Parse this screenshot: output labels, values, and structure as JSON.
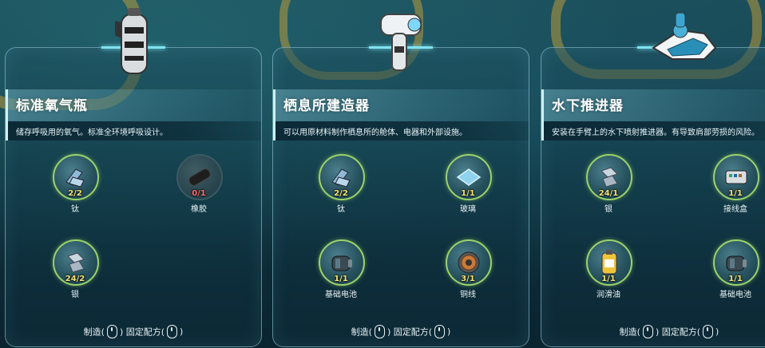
{
  "panels": [
    {
      "title": "标准氧气瓶",
      "description": "储存呼吸用的氧气。标准全环境呼吸设计。",
      "item_icon": "oxygen-tank-icon",
      "ingredients": [
        {
          "name": "钛",
          "count": "2/2",
          "icon": "titanium-icon",
          "available": true
        },
        {
          "name": "橡胶",
          "count": "0/1",
          "icon": "rubber-icon",
          "available": false
        },
        {
          "name": "银",
          "count": "24/2",
          "icon": "silver-icon",
          "available": true
        }
      ],
      "footer": {
        "craft": "制造(",
        "pin": ")   固定配方(",
        "end": ")"
      }
    },
    {
      "title": "栖息所建造器",
      "description": "可以用原材料制作栖息所的舱体、电器和外部设施。",
      "item_icon": "habitat-builder-icon",
      "ingredients": [
        {
          "name": "钛",
          "count": "2/2",
          "icon": "titanium-icon",
          "available": true
        },
        {
          "name": "玻璃",
          "count": "1/1",
          "icon": "glass-icon",
          "available": true
        },
        {
          "name": "基础电池",
          "count": "1/1",
          "icon": "battery-icon",
          "available": true
        },
        {
          "name": "铜线",
          "count": "3/1",
          "icon": "copper-wire-icon",
          "available": true
        }
      ],
      "footer": {
        "craft": "制造(",
        "pin": ")   固定配方(",
        "end": ")"
      }
    },
    {
      "title": "水下推进器",
      "description": "安装在手臂上的水下喷射推进器。有导致肩部劳损的风险。",
      "item_icon": "propulsion-cannon-icon",
      "ingredients": [
        {
          "name": "银",
          "count": "24/1",
          "icon": "silver-icon",
          "available": true
        },
        {
          "name": "接线盒",
          "count": "1/1",
          "icon": "wiring-kit-icon",
          "available": true
        },
        {
          "name": "润滑油",
          "count": "1/1",
          "icon": "lubricant-icon",
          "available": true
        },
        {
          "name": "基础电池",
          "count": "1/1",
          "icon": "battery-icon",
          "available": true
        }
      ],
      "footer": {
        "craft": "制造(",
        "pin": ")   固定配方(",
        "end": ")"
      }
    }
  ],
  "colors": {
    "available_border": "#9bd36a",
    "count_ok": "#f3e27a",
    "count_missing": "#ff6a6a",
    "panel_edge": "#7fe3f0"
  }
}
